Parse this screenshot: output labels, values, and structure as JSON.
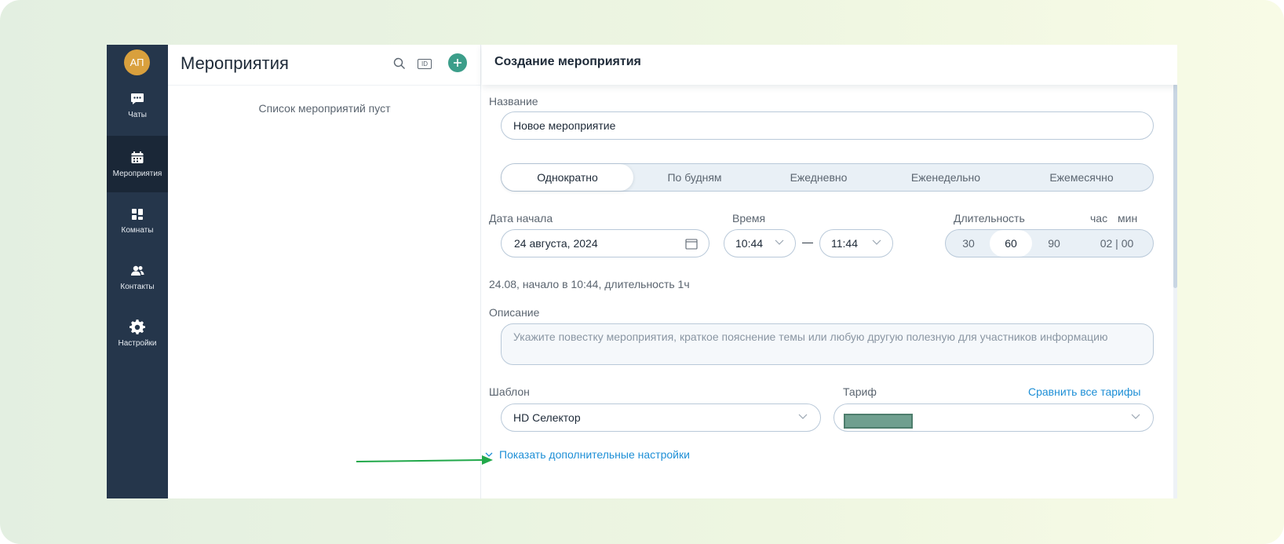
{
  "sidebar": {
    "avatar": "АП",
    "items": [
      {
        "label": "Чаты",
        "icon": "chat-icon",
        "active": false
      },
      {
        "label": "Мероприятия",
        "icon": "calendar-icon",
        "active": true
      },
      {
        "label": "Комнаты",
        "icon": "rooms-icon",
        "active": false
      },
      {
        "label": "Контакты",
        "icon": "contacts-icon",
        "active": false
      },
      {
        "label": "Настройки",
        "icon": "gear-icon",
        "active": false
      }
    ]
  },
  "events_list": {
    "title": "Мероприятия",
    "id_badge": "ID",
    "empty_message": "Список мероприятий пуст"
  },
  "form": {
    "title": "Создание мероприятия",
    "name_label": "Название",
    "name_value": "Новое мероприятие",
    "repeat_tabs": [
      "Однократно",
      "По будням",
      "Ежедневно",
      "Еженедельно",
      "Ежемесячно"
    ],
    "repeat_selected": "Однократно",
    "start_date_label": "Дата начала",
    "start_date_value": "24 августа, 2024",
    "time_label": "Время",
    "time_from": "10:44",
    "time_dash": "—",
    "time_to": "11:44",
    "duration_label": "Длительность",
    "duration_hour_label": "час",
    "duration_min_label": "мин",
    "duration_options": [
      "30",
      "60",
      "90"
    ],
    "duration_selected": "60",
    "duration_custom": "02 | 00",
    "summary": "24.08, начало в 10:44, длительность 1ч",
    "description_label": "Описание",
    "description_placeholder": "Укажите повестку мероприятия, краткое пояснение темы или любую другую полезную для участников информацию",
    "template_label": "Шаблон",
    "template_value": "HD Селектор",
    "tariff_label": "Тариф",
    "compare_tariffs_link": "Сравнить все тарифы",
    "show_more_link": "Показать дополнительные настройки"
  },
  "colors": {
    "accent": "#3c9e8a",
    "link": "#1e8fd6",
    "sidebar": "#25364b",
    "annotation_arrow": "#21a84a"
  }
}
